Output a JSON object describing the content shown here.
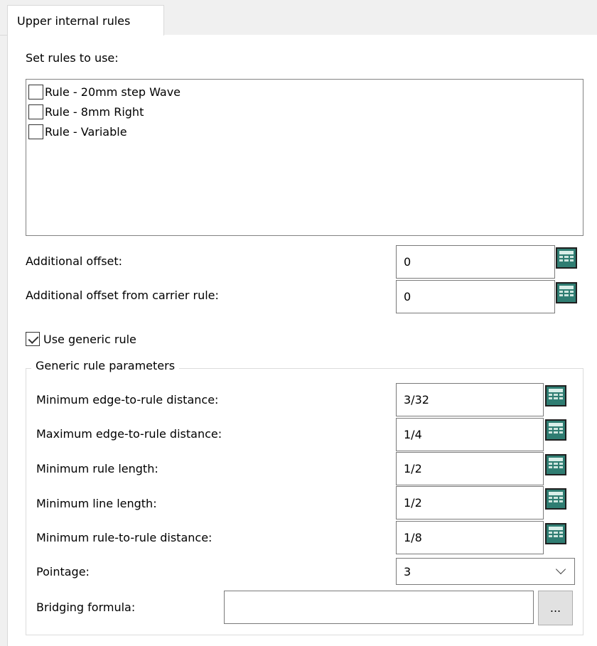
{
  "tab": {
    "label": "Upper internal rules"
  },
  "rules_section": {
    "label": "Set rules to use:",
    "items": [
      {
        "label": "Rule - 20mm step Wave",
        "checked": false
      },
      {
        "label": "Rule - 8mm Right",
        "checked": false
      },
      {
        "label": "Rule - Variable",
        "checked": false
      }
    ]
  },
  "offsets": {
    "additional_offset_label": "Additional offset:",
    "additional_offset_value": "0",
    "carrier_offset_label": "Additional offset from carrier rule:",
    "carrier_offset_value": "0"
  },
  "generic": {
    "use_label": "Use generic rule",
    "use_checked": true,
    "group_title": "Generic rule parameters",
    "min_edge_label": "Minimum edge-to-rule distance:",
    "min_edge_value": "3/32",
    "max_edge_label": "Maximum edge-to-rule distance:",
    "max_edge_value": "1/4",
    "min_rule_len_label": "Minimum rule length:",
    "min_rule_len_value": "1/2",
    "min_line_len_label": "Minimum line length:",
    "min_line_len_value": "1/2",
    "min_rule_dist_label": "Minimum rule-to-rule distance:",
    "min_rule_dist_value": "1/8",
    "pointage_label": "Pointage:",
    "pointage_value": "3",
    "bridging_label": "Bridging formula:",
    "bridging_value": "",
    "browse_label": "..."
  },
  "icons": {
    "calculator": "calculator-icon",
    "dropdown": "chevron-down-icon",
    "checkbox": "checkbox"
  },
  "colors": {
    "calculator": "#2f7d72",
    "panel": "#ffffff",
    "background": "#f0f0f0"
  }
}
